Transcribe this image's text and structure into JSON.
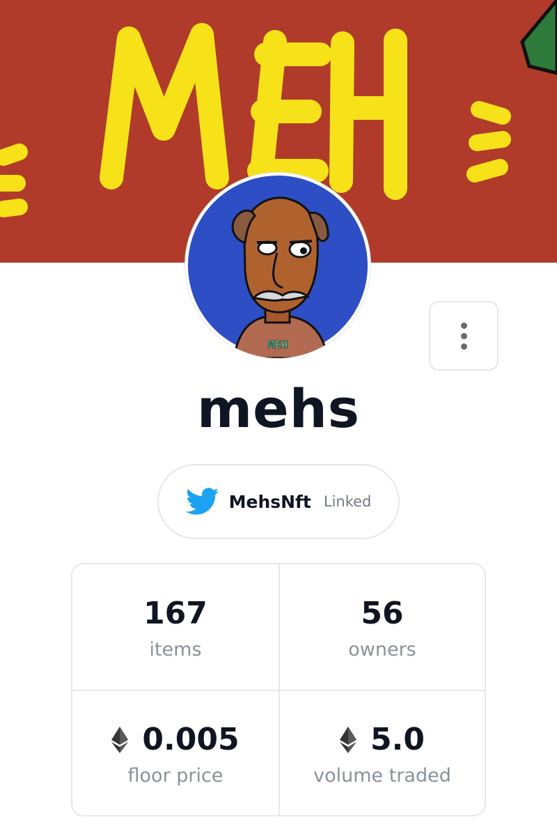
{
  "banner": {
    "text": "MEH",
    "background_color": "#b03b2a",
    "text_color": "#f7e21a"
  },
  "avatar": {
    "shirt_text": "MEH",
    "background_color": "#2d4ec4"
  },
  "more_button": {
    "icon": "more-vertical-icon"
  },
  "collection": {
    "name": "mehs"
  },
  "twitter": {
    "icon": "twitter-icon",
    "handle": "MehsNft",
    "status": "Linked"
  },
  "stats": {
    "items": {
      "value": "167",
      "label": "items"
    },
    "owners": {
      "value": "56",
      "label": "owners"
    },
    "floor_price": {
      "icon": "ethereum-icon",
      "value": "0.005",
      "label": "floor price"
    },
    "volume_traded": {
      "icon": "ethereum-icon",
      "value": "5.0",
      "label": "volume traded"
    }
  },
  "colors": {
    "text_primary": "#0f1522",
    "text_secondary": "#8a939b",
    "border": "#e5e8eb",
    "twitter_blue": "#1da1f2"
  }
}
